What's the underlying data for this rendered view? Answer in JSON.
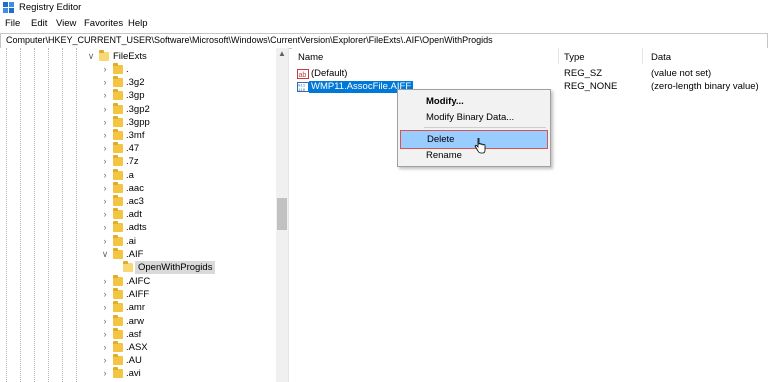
{
  "window": {
    "title": "Registry Editor"
  },
  "menubar": {
    "items": [
      "File",
      "Edit",
      "View",
      "Favorites",
      "Help"
    ]
  },
  "address": {
    "path": "Computer\\HKEY_CURRENT_USER\\Software\\Microsoft\\Windows\\CurrentVersion\\Explorer\\FileExts\\.AIF\\OpenWithProgids"
  },
  "tree": {
    "parent_label": "FileExts",
    "items": [
      ".",
      ".3g2",
      ".3gp",
      ".3gp2",
      ".3gpp",
      ".3mf",
      ".47",
      ".7z",
      ".a",
      ".aac",
      ".ac3",
      ".adt",
      ".adts",
      ".ai",
      ".AIF"
    ],
    "selected_child": "OpenWithProgids",
    "items_after": [
      ".AIFC",
      ".AIFF",
      ".amr",
      ".arw",
      ".asf",
      ".ASX",
      ".AU",
      ".avi"
    ]
  },
  "list": {
    "headers": {
      "name": "Name",
      "type": "Type",
      "data": "Data"
    },
    "rows": [
      {
        "name": "(Default)",
        "type": "REG_SZ",
        "data": "(value not set)",
        "icon": "string-value-icon"
      },
      {
        "name": "WMP11.AssocFile.AIFF",
        "type": "REG_NONE",
        "data": "(zero-length binary value)",
        "icon": "binary-value-icon"
      }
    ]
  },
  "context_menu": {
    "modify": "Modify...",
    "modify_binary": "Modify Binary Data...",
    "delete": "Delete",
    "rename": "Rename"
  },
  "colors": {
    "selection": "#0078d7",
    "menu_hover": "#99ccff",
    "menu_hover_border": "#d9534f",
    "folder": "#f4c542"
  }
}
